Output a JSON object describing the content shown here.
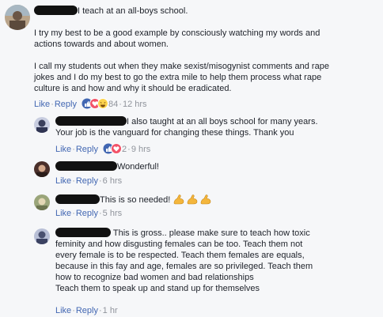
{
  "comments": [
    {
      "author_redacted": true,
      "lines": [
        "I teach at an all-boys school.",
        "",
        "I try my best to be a good example by consciously watching my words and",
        "actions towards and about women.",
        "",
        "I call my students out when they make sexist/misogynist comments and rape",
        "jokes and I do my best to go the extra mile to help them process what rape",
        "culture is and how and why it should be eradicated."
      ],
      "like": "Like",
      "reply": "Reply",
      "reactions": [
        "like",
        "love",
        "haha"
      ],
      "reaction_count": "84",
      "time": "12 hrs"
    },
    {
      "lines": [
        "I also taught at an all boys school for many years.",
        "Your job is the vanguard for changing these things. Thank you"
      ],
      "like": "Like",
      "reply": "Reply",
      "reactions": [
        "like",
        "love"
      ],
      "reaction_count": "2",
      "time": "9 hrs"
    },
    {
      "lines": [
        "Wonderful!"
      ],
      "like": "Like",
      "reply": "Reply",
      "time": "6 hrs"
    },
    {
      "lines": [
        "This is so needed!"
      ],
      "emoji": "strong-arm-emoji-x3",
      "like": "Like",
      "reply": "Reply",
      "time": "5 hrs"
    },
    {
      "lines": [
        "This is gross.. please make sure to teach how toxic",
        "feminity and how disgusting females can be too. Teach them not",
        "every female is to be respected. Teach them females are equals,",
        "because in this fay and age, females are so privileged. Teach them",
        "how to recognize bad women and bad relationships",
        "Teach them to speak up and stand up for themselves"
      ],
      "like": "Like",
      "reply": "Reply",
      "time": "1 hr"
    }
  ],
  "colors": {
    "link": "#4267b2",
    "meta": "#90949c",
    "text": "#1d2129",
    "background": "#f6f7f9"
  }
}
